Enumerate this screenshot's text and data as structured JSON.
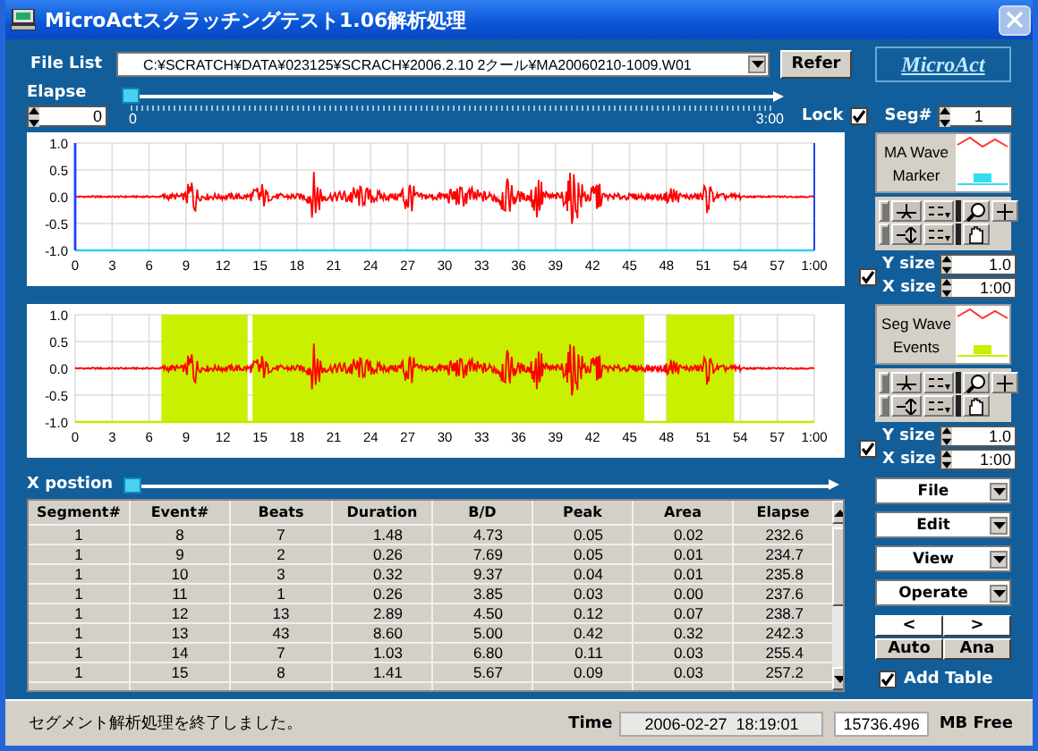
{
  "window": {
    "title": "MicroActスクラッチングテスト1.06解析処理"
  },
  "file_list": {
    "label": "File List",
    "value": "C:¥SCRATCH¥DATA¥023125¥SCRACH¥2006.2.10 2クール¥MA20060210-1009.W01"
  },
  "refer_button": "Refer",
  "logo": "MicroAct",
  "elapse": {
    "label": "Elapse",
    "value": "0",
    "level": 0,
    "scale_start": "0",
    "scale_end": "3:00"
  },
  "lock": {
    "label": "Lock",
    "checked": true
  },
  "segment": {
    "label": "Seg#",
    "value": "1"
  },
  "charts": [
    {
      "kind": "marker",
      "legend": [
        "MA Wave",
        "Marker"
      ],
      "y_ticks": [
        "1.0",
        "0.5",
        "0.0",
        "-0.5",
        "-1.0"
      ],
      "x_ticks": [
        "0",
        "3",
        "6",
        "9",
        "12",
        "15",
        "18",
        "21",
        "24",
        "27",
        "30",
        "33",
        "36",
        "39",
        "42",
        "45",
        "48",
        "51",
        "54",
        "57",
        "1:00"
      ],
      "checked": true,
      "y_label": "Y size",
      "y_size": "1.0",
      "x_label": "X size",
      "x_size": "1:00"
    },
    {
      "kind": "events",
      "legend": [
        "Seg Wave",
        "Events"
      ],
      "y_ticks": [
        "1.0",
        "0.5",
        "0.0",
        "-0.5",
        "-1.0"
      ],
      "x_ticks": [
        "0",
        "3",
        "6",
        "9",
        "12",
        "15",
        "18",
        "21",
        "24",
        "27",
        "30",
        "33",
        "36",
        "39",
        "42",
        "45",
        "48",
        "51",
        "54",
        "57",
        "1:00"
      ],
      "checked": true,
      "y_label": "Y size",
      "y_size": "1.0",
      "x_label": "X size",
      "x_size": "1:00"
    }
  ],
  "x_position": {
    "label": "X postion",
    "level": 0
  },
  "table": {
    "columns": [
      "Segment#",
      "Event#",
      "Beats",
      "Duration",
      "B/D",
      "Peak",
      "Area",
      "Elapse"
    ],
    "rows": [
      [
        "1",
        "8",
        "7",
        "1.48",
        "4.73",
        "0.05",
        "0.02",
        "232.6"
      ],
      [
        "1",
        "9",
        "2",
        "0.26",
        "7.69",
        "0.05",
        "0.01",
        "234.7"
      ],
      [
        "1",
        "10",
        "3",
        "0.32",
        "9.37",
        "0.04",
        "0.01",
        "235.8"
      ],
      [
        "1",
        "11",
        "1",
        "0.26",
        "3.85",
        "0.03",
        "0.00",
        "237.6"
      ],
      [
        "1",
        "12",
        "13",
        "2.89",
        "4.50",
        "0.12",
        "0.07",
        "238.7"
      ],
      [
        "1",
        "13",
        "43",
        "8.60",
        "5.00",
        "0.42",
        "0.32",
        "242.3"
      ],
      [
        "1",
        "14",
        "7",
        "1.03",
        "6.80",
        "0.11",
        "0.03",
        "255.4"
      ],
      [
        "1",
        "15",
        "8",
        "1.41",
        "5.67",
        "0.09",
        "0.03",
        "257.2"
      ]
    ]
  },
  "menus": [
    {
      "label": "File"
    },
    {
      "label": "Edit"
    },
    {
      "label": "View"
    },
    {
      "label": "Operate"
    }
  ],
  "nav_buttons": [
    "<",
    ">"
  ],
  "action_buttons": [
    "Auto",
    "Ana"
  ],
  "add_table": {
    "label": "Add Table",
    "checked": true
  },
  "status": {
    "message": "セグメント解析処理を終了しました。",
    "time_label": "Time",
    "time": "2006-02-27  18:19:01",
    "free": "15736.496",
    "free_label": "MB Free"
  }
}
